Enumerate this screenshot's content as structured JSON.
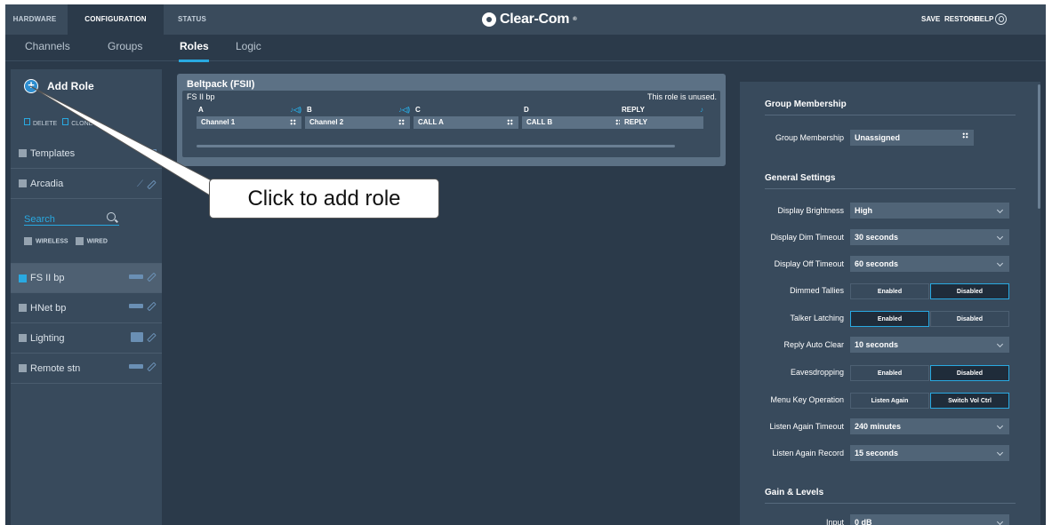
{
  "topbar": {
    "tabs": [
      "HARDWARE",
      "CONFIGURATION",
      "STATUS"
    ],
    "active_tab": "CONFIGURATION",
    "logo": "Clear-Com",
    "logo_mark": "®",
    "actions": [
      "SAVE",
      "RESTORE",
      "HELP"
    ]
  },
  "subnav": {
    "tabs": [
      "Channels",
      "Groups",
      "Roles",
      "Logic"
    ],
    "active_tab": "Roles"
  },
  "sidebar": {
    "add_role": "Add Role",
    "delete": "DELETE",
    "clone": "CLONE",
    "templates": "Templates",
    "arcadia": "Arcadia",
    "search_placeholder": "Search",
    "filter_wireless": "WIRELESS",
    "filter_wired": "WIRED",
    "roles": [
      {
        "label": "FS II bp",
        "selected": true
      },
      {
        "label": "HNet bp",
        "selected": false
      },
      {
        "label": "Lighting",
        "selected": false
      },
      {
        "label": "Remote stn",
        "selected": false
      }
    ]
  },
  "beltpack": {
    "title": "Beltpack (FSII)",
    "name": "FS II bp",
    "status": "This role is unused.",
    "keys": [
      {
        "label": "A",
        "value": "Channel 1"
      },
      {
        "label": "B",
        "value": "Channel 2"
      },
      {
        "label": "C",
        "value": "CALL A"
      },
      {
        "label": "D",
        "value": "CALL B"
      },
      {
        "label": "REPLY",
        "value": "REPLY"
      }
    ]
  },
  "callout": "Click to add role",
  "settings": {
    "group_membership_heading": "Group Membership",
    "group_membership_label": "Group Membership",
    "group_membership_value": "Unassigned",
    "general_heading": "General Settings",
    "display_brightness_label": "Display Brightness",
    "display_brightness_value": "High",
    "display_dim_label": "Display Dim Timeout",
    "display_dim_value": "30 seconds",
    "display_off_label": "Display Off Timeout",
    "display_off_value": "60 seconds",
    "dimmed_tallies_label": "Dimmed Tallies",
    "talker_latching_label": "Talker Latching",
    "reply_auto_clear_label": "Reply Auto Clear",
    "reply_auto_clear_value": "10 seconds",
    "eavesdropping_label": "Eavesdropping",
    "menu_key_label": "Menu Key Operation",
    "menu_key_opt1": "Listen Again",
    "menu_key_opt2": "Switch Vol Ctrl",
    "listen_again_timeout_label": "Listen Again Timeout",
    "listen_again_timeout_value": "240 minutes",
    "listen_again_record_label": "Listen Again Record",
    "listen_again_record_value": "15 seconds",
    "gain_heading": "Gain & Levels",
    "input_label": "Input",
    "input_value": "0 dB",
    "enabled": "Enabled",
    "disabled": "Disabled"
  },
  "colors": {
    "accent": "#29a9e1",
    "bg": "#2b3a4a",
    "panel": "#384a5c"
  }
}
